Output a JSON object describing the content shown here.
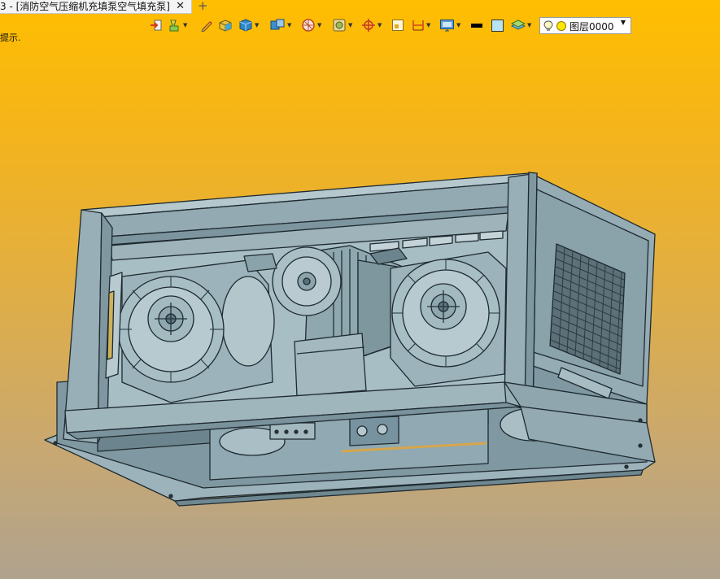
{
  "tabs": [
    {
      "title": "3 - [消防空气压缩机充填泵空气填充泵]",
      "close": "✕",
      "active": true
    }
  ],
  "new_tab_label": "+",
  "hint_text": "提示.",
  "toolbar": {
    "layer_name": "图层0000"
  },
  "colors": {
    "model_fill": "#8FAAB3",
    "model_stroke": "#1E2A30",
    "background_top": "#FFBE00",
    "background_bottom": "#AFA28E"
  }
}
